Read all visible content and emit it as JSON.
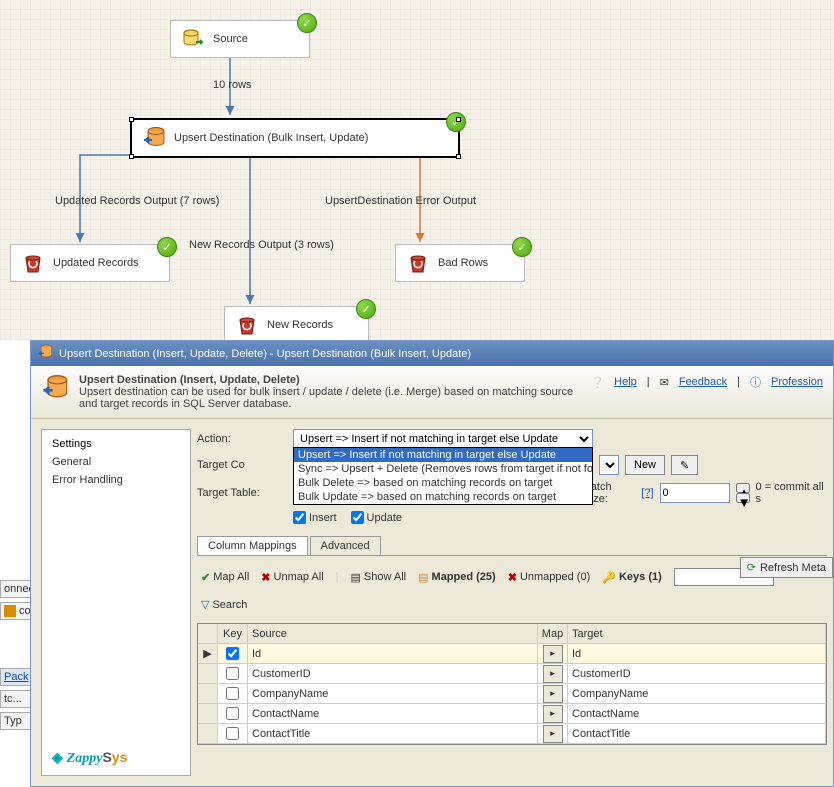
{
  "canvas": {
    "nodes": {
      "source": {
        "label": "Source"
      },
      "upsert_dest": {
        "label": "Upsert Destination (Bulk Insert, Update)"
      },
      "updated": {
        "label": "Updated Records"
      },
      "new": {
        "label": "New Records"
      },
      "bad": {
        "label": "Bad Rows"
      }
    },
    "edges": {
      "rows10": "10 rows",
      "updated_out": "Updated Records Output (7 rows)",
      "new_out": "New Records Output (3 rows)",
      "err_out": "UpsertDestination Error Output"
    }
  },
  "dialog": {
    "title": "Upsert Destination (Insert, Update, Delete) - Upsert Destination (Bulk Insert, Update)",
    "head_title": "Upsert Destination (Insert, Update, Delete)",
    "head_desc": "Upsert destination can be used for bulk insert / update / delete (i.e. Merge) based on matching source and target records in SQL Server database.",
    "links": {
      "help": "Help",
      "feedback": "Feedback",
      "prof": "Profession"
    }
  },
  "side_tabs": [
    "Settings",
    "General",
    "Error Handling"
  ],
  "form": {
    "action_label": "Action:",
    "action_value": "Upsert => Insert if not matching in target else Update",
    "action_options": [
      "Upsert => Insert if not matching in target else Update",
      "Sync => Upsert + Delete (Removes rows from target if not fou",
      "Bulk Delete => based on matching records on target",
      "Bulk Update => based on matching records on target"
    ],
    "target_conn_label": "Target Co",
    "new_btn": "New",
    "target_table_label": "Target Table:",
    "batch_label": "Batch Size:",
    "batch_help": "[?]",
    "batch_value": "0",
    "batch_note": "0 = commit all s",
    "insert_label": "Insert",
    "update_label": "Update"
  },
  "inner_tabs": {
    "col": "Column Mappings",
    "adv": "Advanced"
  },
  "refresh": "Refresh Meta",
  "toolbar": {
    "mapall": "Map All",
    "unmapall": "Unmap All",
    "showall": "Show All",
    "mapped": "Mapped (25)",
    "unmapped": "Unmapped (0)",
    "keys": "Keys (1)",
    "search": "Search"
  },
  "grid": {
    "hdr": {
      "key": "Key",
      "source": "Source",
      "map": "Map",
      "target": "Target"
    },
    "rows": [
      {
        "key": true,
        "source": "Id",
        "target": "Id",
        "iskey": true,
        "ptr": true
      },
      {
        "key": false,
        "source": "CustomerID",
        "target": "CustomerID",
        "iskey": false
      },
      {
        "key": false,
        "source": "CompanyName",
        "target": "CompanyName",
        "iskey": false
      },
      {
        "key": false,
        "source": "ContactName",
        "target": "ContactName",
        "iskey": false
      },
      {
        "key": false,
        "source": "ContactTitle",
        "target": "ContactTitle",
        "iskey": false
      }
    ]
  },
  "left_strip": {
    "connect": "onnect",
    "con": "con",
    "pack": "Pack",
    "tc": "tc...",
    "typ": "Typ"
  },
  "logo": {
    "text": "ZappySys"
  }
}
